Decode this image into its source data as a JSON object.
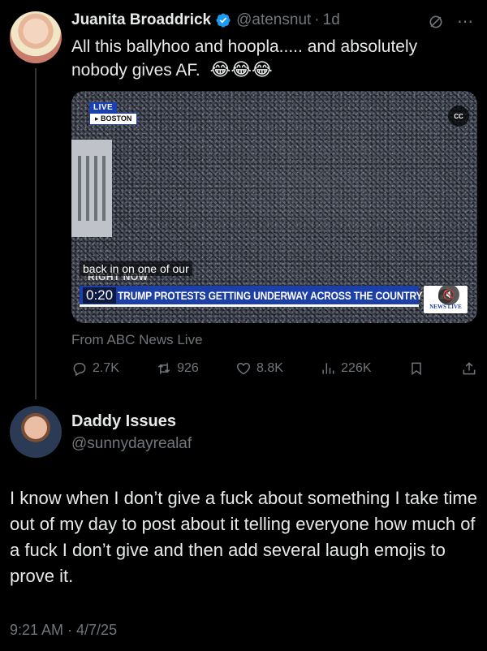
{
  "tweet1": {
    "name": "Juanita Broaddrick",
    "handle": "@atensnut",
    "separator": "·",
    "time": "1d",
    "text": "All this ballyhoo and hoopla..... and absolutely nobody gives AF.",
    "emojis": "😂😂😂",
    "media": {
      "live_badge": "LIVE",
      "location_badge": "▸ BOSTON",
      "cc_label": "CC",
      "caption": "back in on one of our",
      "right_now": "RIGHT NOW",
      "timer": "0:20",
      "headline": "TRUMP PROTESTS GETTING UNDERWAY ACROSS THE COUNTRY",
      "network_logo_text": "abc",
      "network_label": "NEWS LIVE"
    },
    "source": "From ABC News Live",
    "actions": {
      "replies": "2.7K",
      "reposts": "926",
      "likes": "8.8K",
      "views": "226K"
    }
  },
  "tweet2": {
    "name": "Daddy Issues",
    "handle": "@sunnydayrealaf",
    "text": "I know when I don’t give a fuck about something I take time out of my day to post about it telling everyone how much of a fuck I don’t give and then add several laugh emojis to prove it.",
    "timestamp": "9:21 AM · 4/7/25"
  },
  "colors": {
    "background": "#000000",
    "text_primary": "#e7e9ea",
    "text_secondary": "#71767b",
    "verified": "#1d9bf0",
    "abc_blue": "#1d3fa8"
  }
}
